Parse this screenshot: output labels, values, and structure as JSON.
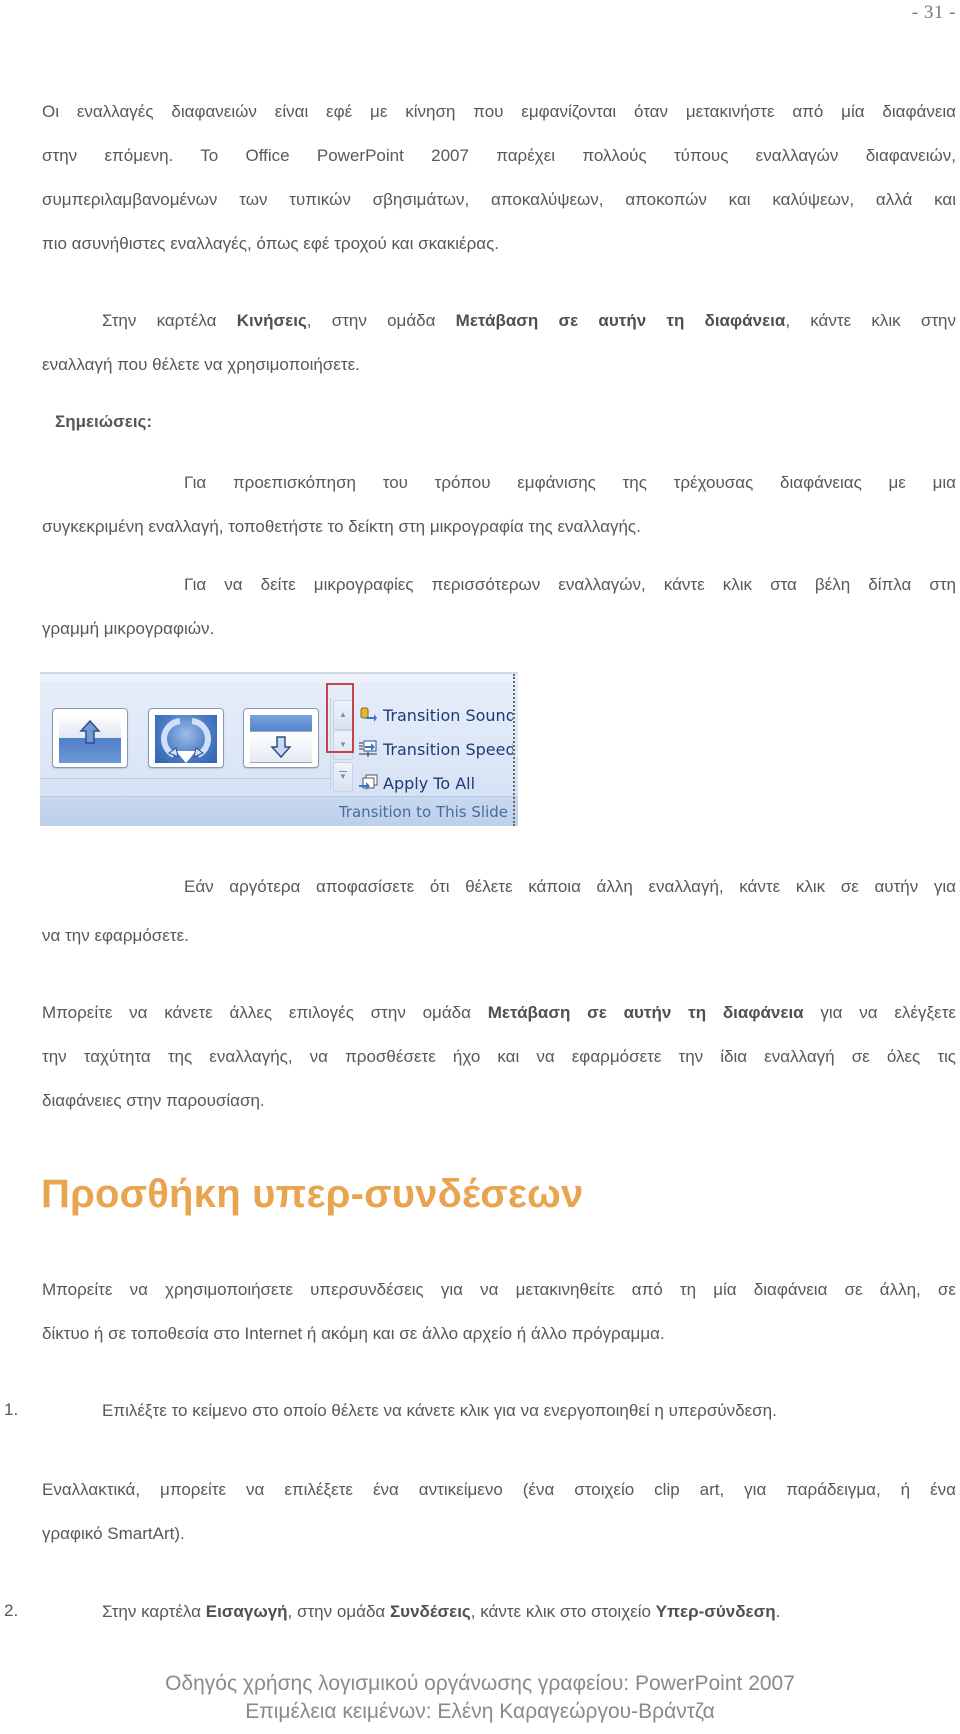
{
  "page_number": "- 31 -",
  "intro": {
    "lines": [
      "Οι εναλλαγές διαφανειών είναι εφέ με κίνηση που εμφανίζονται όταν μετακινήστε από μία διαφάνεια",
      "στην επόμενη. Το Office PowerPoint 2007 παρέχει πολλούς τύπους εναλλαγών διαφανειών,",
      "συμπεριλαμβανομένων των τυπικών σβησιμάτων, αποκαλύψεων, αποκοπών και καλύψεων, αλλά και",
      "πιο ασυνήθιστες εναλλαγές, όπως εφέ τροχού και σκακιέρας."
    ]
  },
  "instruction": {
    "part1": "Στην καρτέλα ",
    "bold1": "Κινήσεις",
    "part2": ", στην ομάδα ",
    "bold2": "Μετάβαση σε αυτήν τη διαφάνεια",
    "part3": ", κάντε κλικ στην",
    "line2": "εναλλαγή που θέλετε να χρησιμοποιήσετε."
  },
  "notes": {
    "label": "Σημειώσεις:",
    "note1_line1": "Για προεπισκόπηση του τρόπου εμφάνισης της τρέχουσας διαφάνειας με μια",
    "note1_line2": "συγκεκριμένη εναλλαγή, τοποθετήστε το δείκτη στη μικρογραφία της εναλλαγής.",
    "note2_line1": "Για να δείτε μικρογραφίες περισσότερων εναλλαγών, κάντε κλικ στα βέλη δίπλα στη",
    "note2_line2": "γραμμή μικρογραφιών."
  },
  "ribbon": {
    "thumbnails": [
      {
        "name": "push-up",
        "icon": "arrow-up-icon"
      },
      {
        "name": "wheel",
        "icon": "circular-arrows-icon"
      },
      {
        "name": "cover-down",
        "icon": "arrow-down-icon"
      }
    ],
    "scroll_up": "▲",
    "scroll_down": "▼",
    "more": "▼",
    "commands": [
      {
        "label": "Transition Sound",
        "icon": "sound-icon"
      },
      {
        "label": "Transition Speed",
        "icon": "speed-icon"
      },
      {
        "label": "Apply To All",
        "icon": "apply-all-icon"
      }
    ],
    "group_label": "Transition to This Slide",
    "highlight_color": "#c8424a"
  },
  "later": {
    "line1": "Εάν αργότερα αποφασίσετε ότι θέλετε κάποια άλλη εναλλαγή, κάντε κλικ σε αυτήν για",
    "line2": "να την εφαρμόσετε."
  },
  "options": {
    "part1": "Μπορείτε να κάνετε άλλες επιλογές στην ομάδα ",
    "bold1": "Μετάβαση σε αυτήν τη διαφάνεια",
    "part2": " για να ελέγξετε",
    "line2": "την ταχύτητα της εναλλαγής, να προσθέσετε ήχο και να εφαρμόσετε την ίδια εναλλαγή σε όλες τις",
    "line3": "διαφάνειες στην παρουσίαση."
  },
  "section": {
    "heading": "Προσθήκη υπερ-συνδέσεων",
    "heading_color": "#E9A450",
    "intro_line1": "Μπορείτε να χρησιμοποιήσετε υπερσυνδέσεις για να μετακινηθείτε από τη μία διαφάνεια σε άλλη, σε",
    "intro_line2": "δίκτυο ή σε τοποθεσία στο Internet ή ακόμη και σε άλλο αρχείο ή άλλο πρόγραμμα."
  },
  "steps": [
    {
      "number": "1.",
      "text": "Επιλέξτε το κείμενο στο οποίο θέλετε να κάνετε κλικ για να ενεργοποιηθεί η υπερσύνδεση."
    },
    {
      "number": "2.",
      "part1": "Στην καρτέλα ",
      "bold1": "Εισαγωγή",
      "part2": ", στην ομάδα ",
      "bold2": "Συνδέσεις",
      "part3": ", κάντε κλικ στο στοιχείο ",
      "bold3": "Υπερ-σύνδεση",
      "part4": "."
    }
  ],
  "alternative": {
    "line1": "Εναλλακτικά, μπορείτε να επιλέξετε ένα αντικείμενο (ένα στοιχείο clip art, για παράδειγμα, ή ένα",
    "line2": "γραφικό SmartArt)."
  },
  "footer": {
    "line1": "Οδηγός χρήσης λογισμικού οργάνωσης γραφείου: PowerPoint 2007",
    "line2": "Επιμέλεια κειμένων: Ελένη Καραγεώργου-Βράντζα"
  }
}
